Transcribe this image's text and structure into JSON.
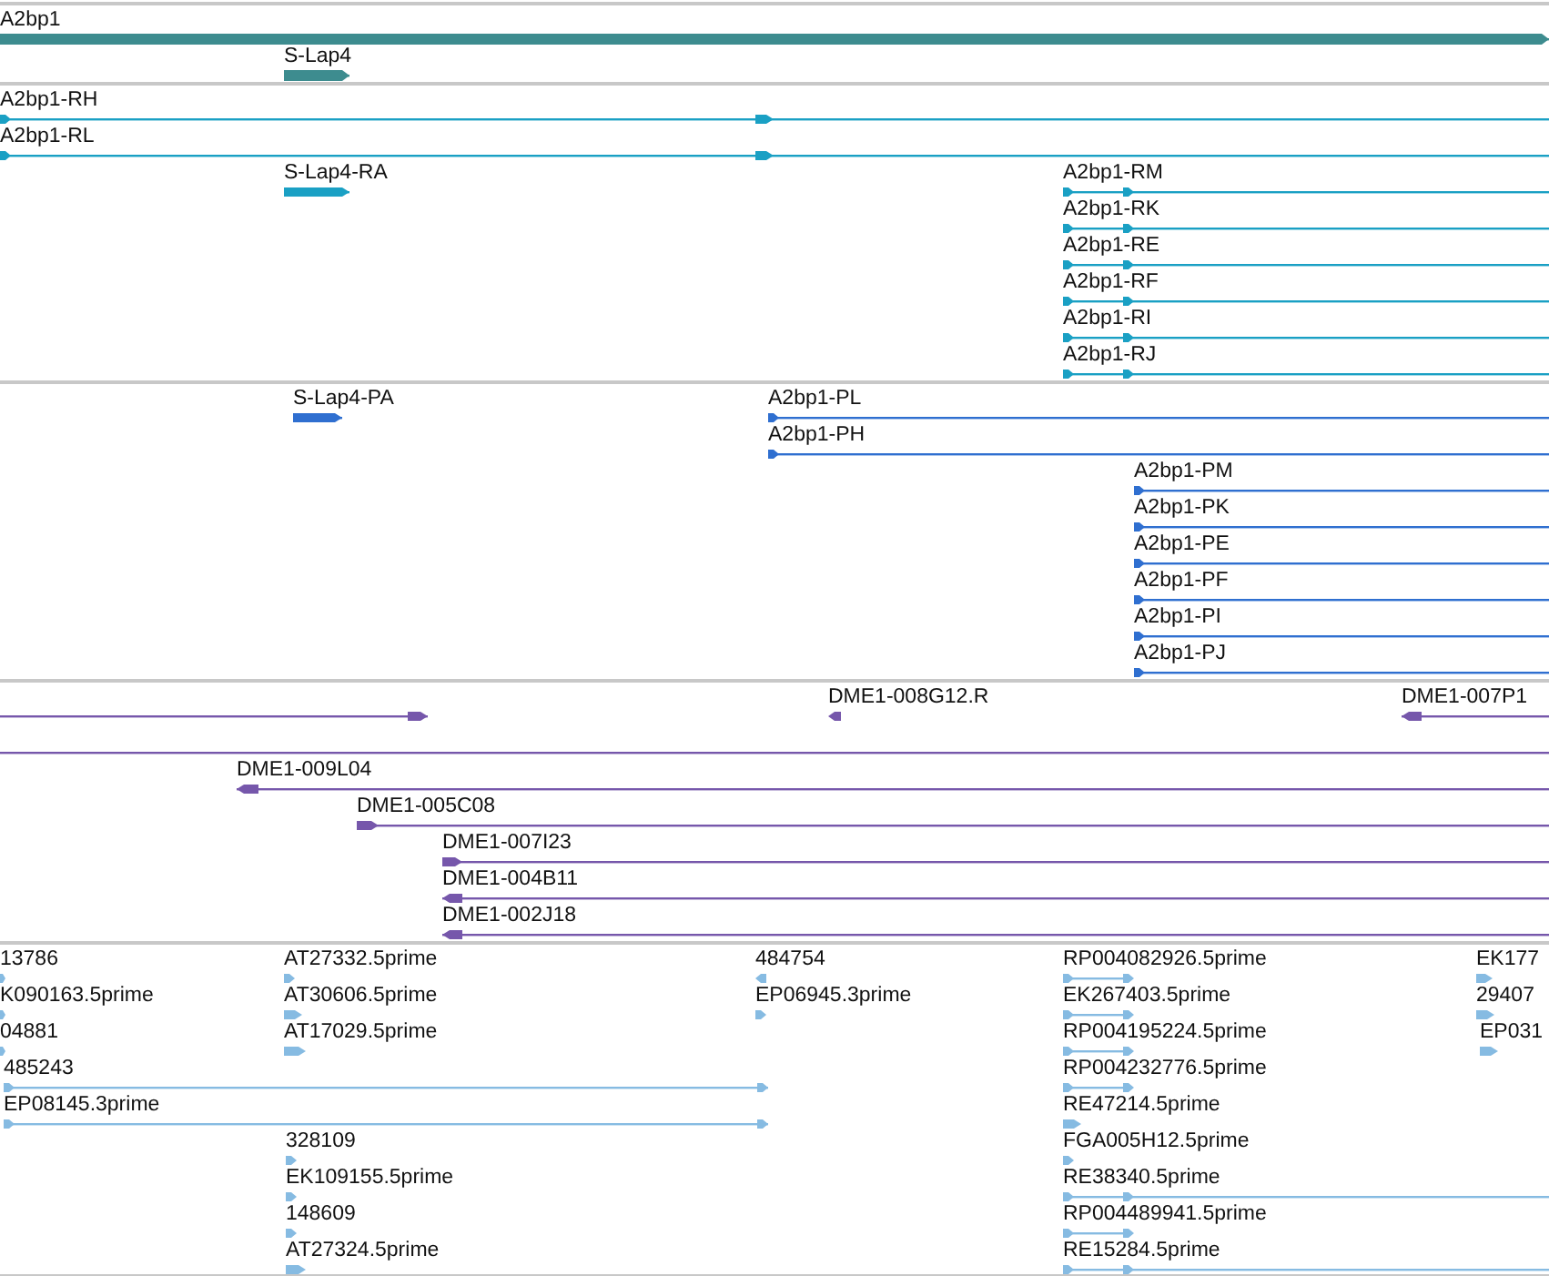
{
  "tracks": [
    {
      "kind": "gene",
      "color": "#3d8c8f",
      "features": [
        {
          "label": "A2bp1",
          "kind": "arrow",
          "reverse": false
        },
        {
          "label": "S-Lap4",
          "kind": "arrow",
          "reverse": false
        }
      ]
    },
    {
      "kind": "transcript",
      "color": "#1aa0c4",
      "features": [
        {
          "label": "A2bp1-RH",
          "kind": "arrow",
          "reverse": false
        },
        {
          "label": "A2bp1-RL",
          "kind": "arrow",
          "reverse": false
        },
        {
          "label": "S-Lap4-RA",
          "kind": "arrow",
          "reverse": false
        },
        {
          "label": "A2bp1-RM",
          "kind": "arrow",
          "reverse": false
        },
        {
          "label": "A2bp1-RK",
          "kind": "arrow",
          "reverse": false
        },
        {
          "label": "A2bp1-RE",
          "kind": "arrow",
          "reverse": false
        },
        {
          "label": "A2bp1-RF",
          "kind": "arrow",
          "reverse": false
        },
        {
          "label": "A2bp1-RI",
          "kind": "arrow",
          "reverse": false
        },
        {
          "label": "A2bp1-RJ",
          "kind": "arrow",
          "reverse": false
        }
      ]
    },
    {
      "kind": "protein",
      "color": "#2f6fd0",
      "features": [
        {
          "label": "S-Lap4-PA",
          "kind": "arrow",
          "reverse": false
        },
        {
          "label": "A2bp1-PL",
          "kind": "arrow",
          "reverse": false
        },
        {
          "label": "A2bp1-PH",
          "kind": "arrow",
          "reverse": false
        },
        {
          "label": "A2bp1-PM",
          "kind": "arrow",
          "reverse": false
        },
        {
          "label": "A2bp1-PK",
          "kind": "arrow",
          "reverse": false
        },
        {
          "label": "A2bp1-PE",
          "kind": "arrow",
          "reverse": false
        },
        {
          "label": "A2bp1-PF",
          "kind": "arrow",
          "reverse": false
        },
        {
          "label": "A2bp1-PI",
          "kind": "arrow",
          "reverse": false
        },
        {
          "label": "A2bp1-PJ",
          "kind": "arrow",
          "reverse": false
        }
      ]
    },
    {
      "kind": "clone",
      "color": "#7657ab",
      "features": [
        {
          "kind": "arrow",
          "reverse": false
        },
        {
          "label": "DME1-008G12.R",
          "kind": "arrow",
          "reverse": true
        },
        {
          "label": "DME1-007P1",
          "kind": "arrow",
          "reverse": true
        },
        {
          "kind": "line"
        },
        {
          "label": "DME1-009L04",
          "kind": "arrow",
          "reverse": true
        },
        {
          "label": "DME1-005C08",
          "kind": "arrow",
          "reverse": false
        },
        {
          "label": "DME1-007I23",
          "kind": "arrow",
          "reverse": false
        },
        {
          "label": "DME1-004B11",
          "kind": "arrow",
          "reverse": true
        },
        {
          "label": "DME1-002J18",
          "kind": "arrow",
          "reverse": true
        }
      ]
    },
    {
      "kind": "est",
      "color": "#86bbe2",
      "features": [
        {
          "label": "13786",
          "kind": "arrow",
          "reverse": false
        },
        {
          "label": "K090163.5prime",
          "kind": "arrow",
          "reverse": false
        },
        {
          "label": "04881",
          "kind": "arrow",
          "reverse": false
        },
        {
          "label": "485243",
          "kind": "arrow",
          "reverse": false
        },
        {
          "label": "EP08145.3prime",
          "kind": "arrow",
          "reverse": false
        },
        {
          "label": "AT27332.5prime",
          "kind": "arrow",
          "reverse": false
        },
        {
          "label": "AT30606.5prime",
          "kind": "arrow",
          "reverse": false
        },
        {
          "label": "AT17029.5prime",
          "kind": "arrow",
          "reverse": false
        },
        {
          "label": "328109",
          "kind": "arrow",
          "reverse": false
        },
        {
          "label": "EK109155.5prime",
          "kind": "arrow",
          "reverse": false
        },
        {
          "label": "148609",
          "kind": "arrow",
          "reverse": false
        },
        {
          "label": "AT27324.5prime",
          "kind": "arrow",
          "reverse": false
        },
        {
          "label": "484754",
          "kind": "arrow",
          "reverse": true
        },
        {
          "label": "EP06945.3prime",
          "kind": "arrow",
          "reverse": false
        },
        {
          "label": "RP004082926.5prime",
          "kind": "arrow",
          "reverse": false
        },
        {
          "label": "EK267403.5prime",
          "kind": "arrow",
          "reverse": false
        },
        {
          "label": "RP004195224.5prime",
          "kind": "arrow",
          "reverse": false
        },
        {
          "label": "RP004232776.5prime",
          "kind": "arrow",
          "reverse": false
        },
        {
          "label": "RE47214.5prime",
          "kind": "arrow",
          "reverse": false
        },
        {
          "label": "FGA005H12.5prime",
          "kind": "arrow",
          "reverse": false
        },
        {
          "label": "RE38340.5prime",
          "kind": "arrow",
          "reverse": false
        },
        {
          "label": "RP004489941.5prime",
          "kind": "arrow",
          "reverse": false
        },
        {
          "label": "RE15284.5prime",
          "kind": "arrow",
          "reverse": false
        },
        {
          "label": "EK177",
          "kind": "arrow",
          "reverse": false
        },
        {
          "label": "29407",
          "kind": "arrow",
          "reverse": false
        },
        {
          "label": "EP031",
          "kind": "arrow",
          "reverse": false
        }
      ]
    }
  ]
}
